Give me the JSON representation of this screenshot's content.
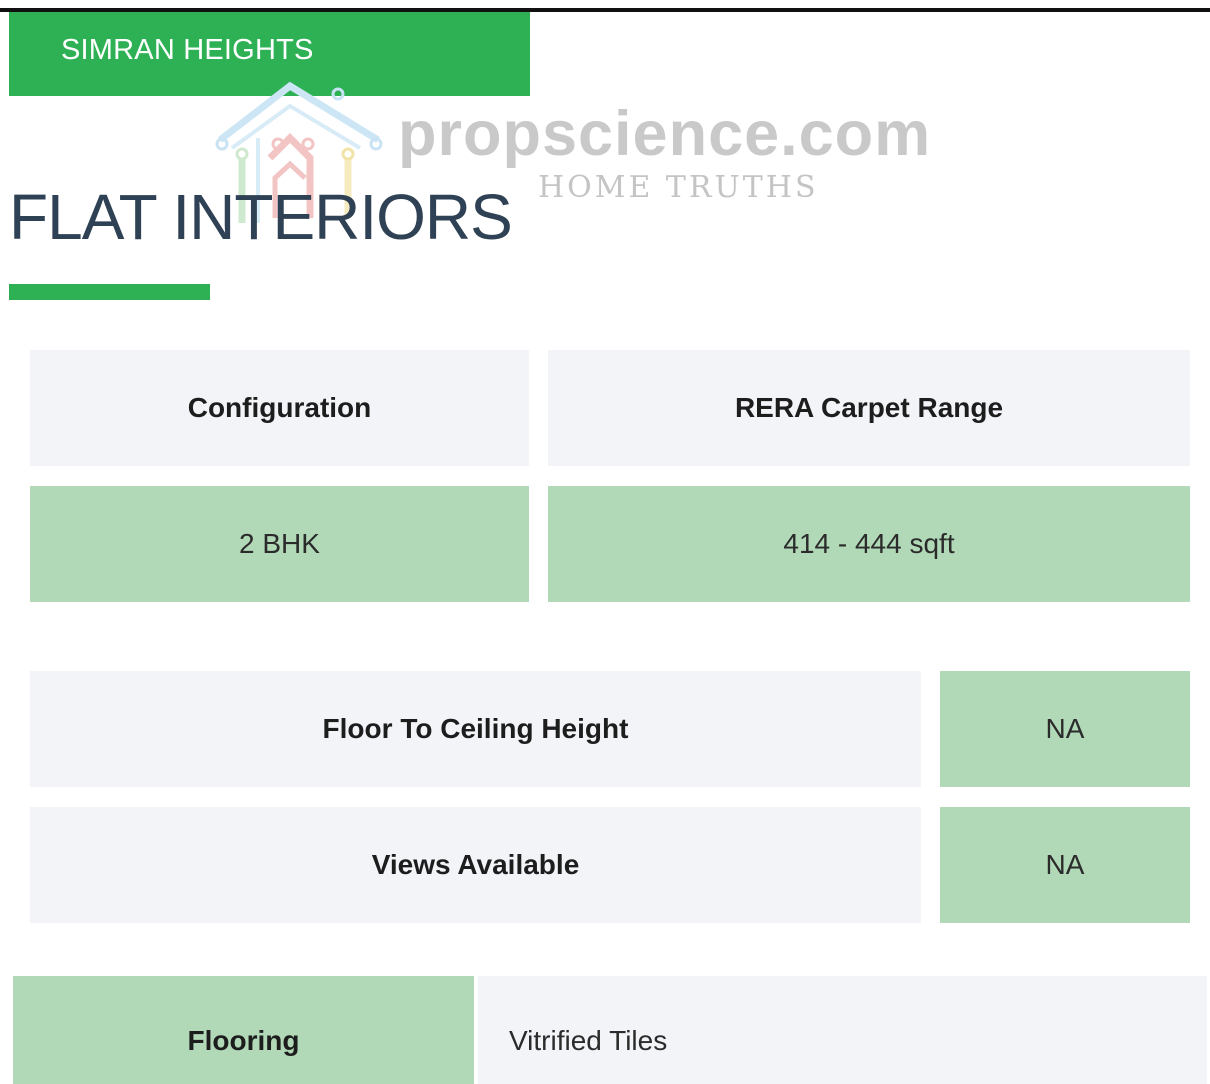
{
  "project": {
    "name": "SIMRAN HEIGHTS"
  },
  "watermark": {
    "brand": "propscience.com",
    "tagline": "HOME TRUTHS"
  },
  "section": {
    "title": "FLAT INTERIORS"
  },
  "summary_table": {
    "headers": [
      "Configuration",
      "RERA Carpet Range"
    ],
    "values": [
      "2 BHK",
      "414 - 444 sqft"
    ]
  },
  "attributes": [
    {
      "label": "Floor To Ceiling Height",
      "value": "NA"
    },
    {
      "label": "Views Available",
      "value": "NA"
    }
  ],
  "flooring": {
    "label": "Flooring",
    "value": "Vitrified Tiles"
  },
  "colors": {
    "accent_green": "#2db154",
    "light_green": "#b1d9b8",
    "light_grey": "#f2f4f8",
    "title_color": "#2f4154"
  }
}
